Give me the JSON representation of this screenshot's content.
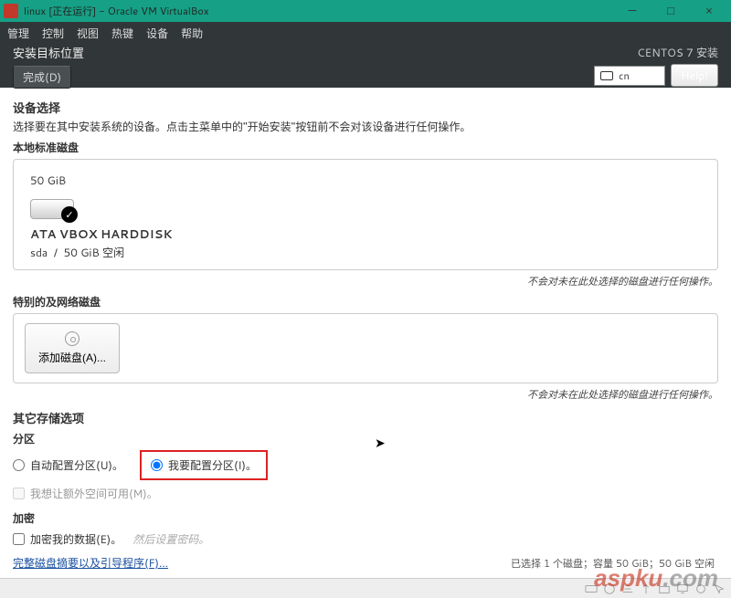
{
  "vbox": {
    "title": "linux [正在运行] - Oracle VM VirtualBox",
    "min": "—",
    "max": "□",
    "close": "×"
  },
  "menu": {
    "manage": "管理",
    "control": "控制",
    "view": "视图",
    "hotkeys": "热键",
    "devices": "设备",
    "help": "帮助"
  },
  "header": {
    "title": "安装目标位置",
    "done": "完成(D)",
    "product": "CENTOS 7 安装",
    "locale": "cn",
    "help": "Help!"
  },
  "device": {
    "title": "设备选择",
    "desc": "选择要在其中安装系统的设备。点击主菜单中的\"开始安装\"按钮前不会对该设备进行任何操作。",
    "local_label": "本地标准磁盘",
    "disk_size": "50 GiB",
    "disk_name": "ATA VBOX HARDDISK",
    "disk_id": "sda",
    "disk_sep": "/",
    "disk_free": "50 GiB 空闲",
    "note": "不会对未在此处选择的磁盘进行任何操作。",
    "special_label": "特别的及网络磁盘",
    "add_disk": "添加磁盘(A)..."
  },
  "storage": {
    "title": "其它存储选项",
    "partition_label": "分区",
    "auto": "自动配置分区(U)。",
    "manual": "我要配置分区(I)。",
    "extra": "我想让额外空间可用(M)。",
    "encrypt_label": "加密",
    "encrypt_opt": "加密我的数据(E)。",
    "encrypt_hint": "然后设置密码。"
  },
  "footer": {
    "link": "完整磁盘摘要以及引导程序(F)...",
    "summary": "已选择 1 个磁盘；容量 50 GiB；50 GiB 空闲"
  },
  "watermark": {
    "a": "aspku",
    "b": ".com"
  }
}
